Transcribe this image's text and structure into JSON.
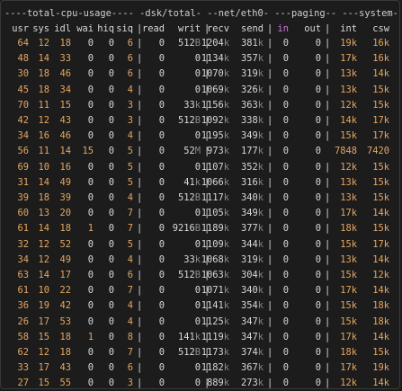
{
  "groups": "----total-cpu-usage---- -dsk/total- --net/eth0- ---paging-- ---system--",
  "columns": [
    "usr",
    "sys",
    "idl",
    "wai",
    "hiq",
    "siq",
    "read",
    "writ",
    "recv",
    "send",
    "in",
    "out",
    "int",
    "csw"
  ],
  "highlight_column": "in",
  "rows": [
    [
      "64",
      "12",
      "18",
      "0",
      "0",
      "6",
      "0",
      "512B",
      "1204k",
      "381k",
      "0",
      "0",
      "19k",
      "16k"
    ],
    [
      "48",
      "14",
      "33",
      "0",
      "0",
      "6",
      "0",
      "0",
      "1134k",
      "357k",
      "0",
      "0",
      "17k",
      "16k"
    ],
    [
      "30",
      "18",
      "46",
      "0",
      "0",
      "6",
      "0",
      "0",
      "1070k",
      "319k",
      "0",
      "0",
      "13k",
      "14k"
    ],
    [
      "45",
      "18",
      "34",
      "0",
      "0",
      "4",
      "0",
      "0",
      "1069k",
      "326k",
      "0",
      "0",
      "13k",
      "15k"
    ],
    [
      "70",
      "11",
      "15",
      "0",
      "0",
      "3",
      "0",
      "33k",
      "1156k",
      "363k",
      "0",
      "0",
      "12k",
      "15k"
    ],
    [
      "42",
      "12",
      "43",
      "0",
      "0",
      "3",
      "0",
      "512B",
      "1092k",
      "338k",
      "0",
      "0",
      "14k",
      "17k"
    ],
    [
      "34",
      "16",
      "46",
      "0",
      "0",
      "4",
      "0",
      "0",
      "1195k",
      "349k",
      "0",
      "0",
      "15k",
      "17k"
    ],
    [
      "56",
      "11",
      "14",
      "15",
      "0",
      "5",
      "0",
      "52M",
      "973k",
      "177k",
      "0",
      "0",
      "7848",
      "7420"
    ],
    [
      "69",
      "10",
      "16",
      "0",
      "0",
      "5",
      "0",
      "0",
      "1107k",
      "352k",
      "0",
      "0",
      "12k",
      "15k"
    ],
    [
      "31",
      "14",
      "49",
      "0",
      "0",
      "5",
      "0",
      "41k",
      "1066k",
      "316k",
      "0",
      "0",
      "13k",
      "15k"
    ],
    [
      "39",
      "18",
      "39",
      "0",
      "0",
      "4",
      "0",
      "512B",
      "1117k",
      "340k",
      "0",
      "0",
      "13k",
      "15k"
    ],
    [
      "60",
      "13",
      "20",
      "0",
      "0",
      "7",
      "0",
      "0",
      "1105k",
      "349k",
      "0",
      "0",
      "17k",
      "14k"
    ],
    [
      "61",
      "14",
      "18",
      "1",
      "0",
      "7",
      "0",
      "9216B",
      "1189k",
      "377k",
      "0",
      "0",
      "18k",
      "15k"
    ],
    [
      "32",
      "12",
      "52",
      "0",
      "0",
      "5",
      "0",
      "0",
      "1109k",
      "344k",
      "0",
      "0",
      "15k",
      "17k"
    ],
    [
      "34",
      "12",
      "49",
      "0",
      "0",
      "4",
      "0",
      "33k",
      "1068k",
      "319k",
      "0",
      "0",
      "13k",
      "14k"
    ],
    [
      "63",
      "14",
      "17",
      "0",
      "0",
      "6",
      "0",
      "512B",
      "1063k",
      "304k",
      "0",
      "0",
      "15k",
      "12k"
    ],
    [
      "61",
      "10",
      "22",
      "0",
      "0",
      "7",
      "0",
      "0",
      "1071k",
      "340k",
      "0",
      "0",
      "17k",
      "14k"
    ],
    [
      "36",
      "19",
      "42",
      "0",
      "0",
      "4",
      "0",
      "0",
      "1141k",
      "354k",
      "0",
      "0",
      "15k",
      "18k"
    ],
    [
      "26",
      "17",
      "53",
      "0",
      "0",
      "4",
      "0",
      "0",
      "1125k",
      "347k",
      "0",
      "0",
      "15k",
      "18k"
    ],
    [
      "58",
      "15",
      "18",
      "1",
      "0",
      "8",
      "0",
      "141k",
      "1119k",
      "347k",
      "0",
      "0",
      "17k",
      "14k"
    ],
    [
      "62",
      "12",
      "18",
      "0",
      "0",
      "7",
      "0",
      "512B",
      "1173k",
      "374k",
      "0",
      "0",
      "18k",
      "15k"
    ],
    [
      "33",
      "17",
      "43",
      "0",
      "0",
      "6",
      "0",
      "0",
      "1182k",
      "367k",
      "0",
      "0",
      "17k",
      "19k"
    ],
    [
      "27",
      "15",
      "55",
      "0",
      "0",
      "3",
      "0",
      "0",
      "889k",
      "273k",
      "0",
      "0",
      "12k",
      "14k"
    ]
  ]
}
